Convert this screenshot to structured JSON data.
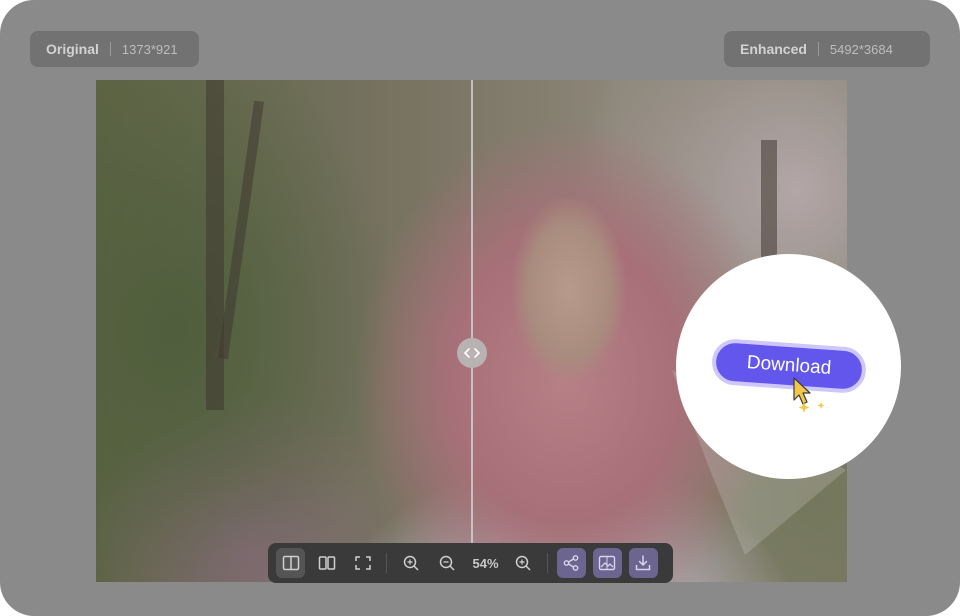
{
  "compare": {
    "original": {
      "label": "Original",
      "dims": "1373*921"
    },
    "enhanced": {
      "label": "Enhanced",
      "dims": "5492*3684"
    }
  },
  "toolbar": {
    "zoom_level": "54%",
    "buttons": [
      "split-view",
      "side-by-side",
      "fullscreen",
      "zoom-in",
      "zoom-out",
      "zoom-in",
      "share",
      "compare-image",
      "download"
    ]
  },
  "callout": {
    "download_label": "Download"
  },
  "colors": {
    "accent": "#6256ec",
    "accent_border": "#cdc7fb",
    "cursor": "#f2c84b"
  }
}
